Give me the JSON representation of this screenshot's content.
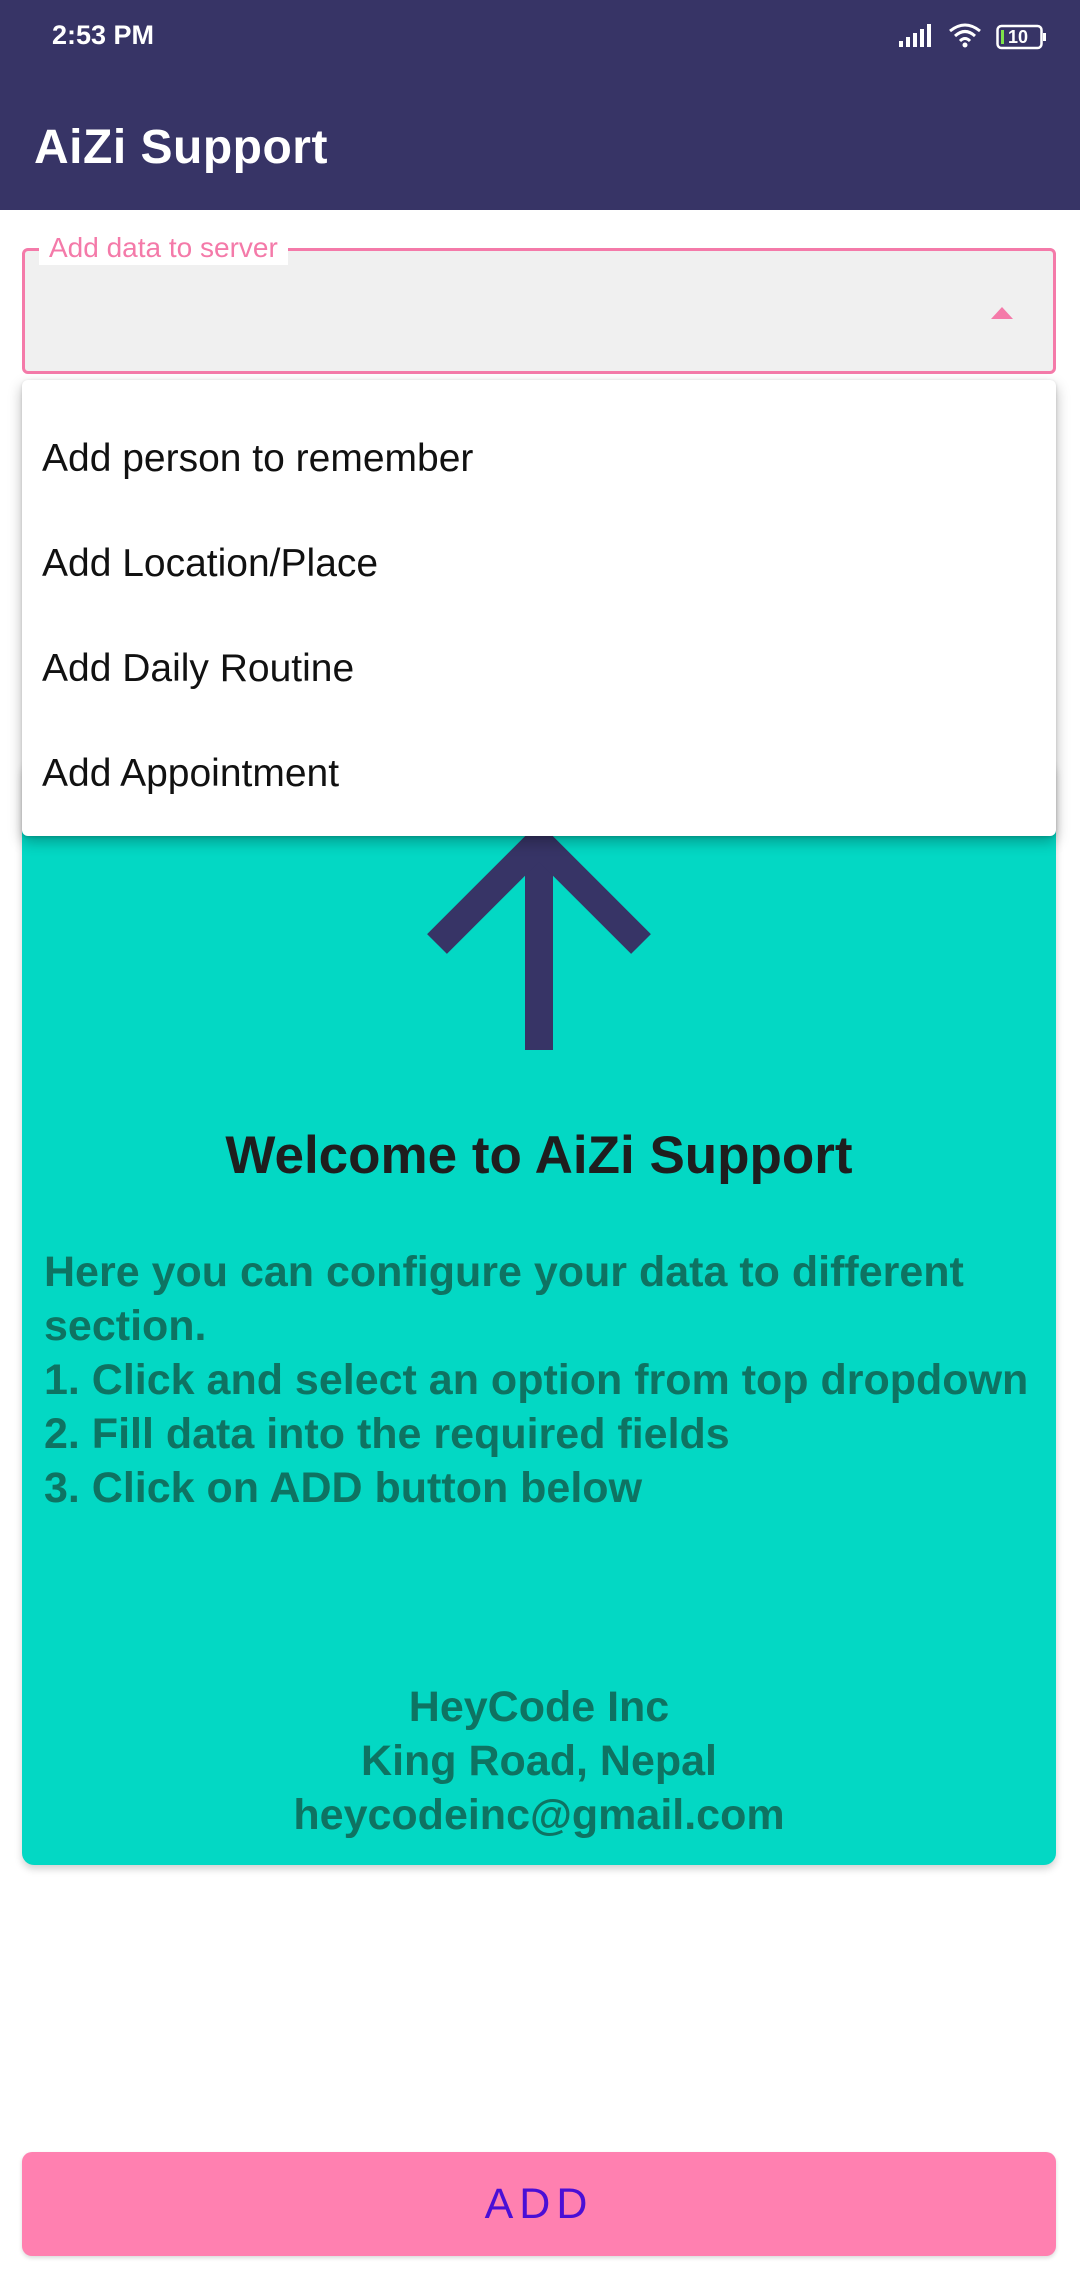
{
  "status_bar": {
    "time": "2:53 PM",
    "battery_level": "10",
    "icons": [
      "signal-icon",
      "wifi-icon",
      "battery-icon"
    ]
  },
  "app_bar": {
    "title": "AiZi Support"
  },
  "dropdown": {
    "label": "Add data to server",
    "value": "",
    "options": [
      "Add person to remember",
      "Add Location/Place",
      "Add Daily Routine",
      "Add Appointment"
    ]
  },
  "welcome_card": {
    "icon": "arrow-up-icon",
    "title": "Welcome to AiZi Support",
    "instructions": [
      "Here you can configure your data to different",
      "section.",
      "1. Click and select an option from top dropdown",
      "2. Fill data into the required fields",
      "3. Click on ADD button below"
    ],
    "company": {
      "name": "HeyCode Inc",
      "address": "King Road, Nepal",
      "email": "heycodeinc@gmail.com"
    }
  },
  "add_button": {
    "label": "ADD"
  },
  "colors": {
    "primary": "#373466",
    "accent": "#f47aa9",
    "card_background": "#03d8c4",
    "card_text": "#0e7362",
    "button_background": "#ff80b0",
    "button_text": "#4a0fd6"
  }
}
